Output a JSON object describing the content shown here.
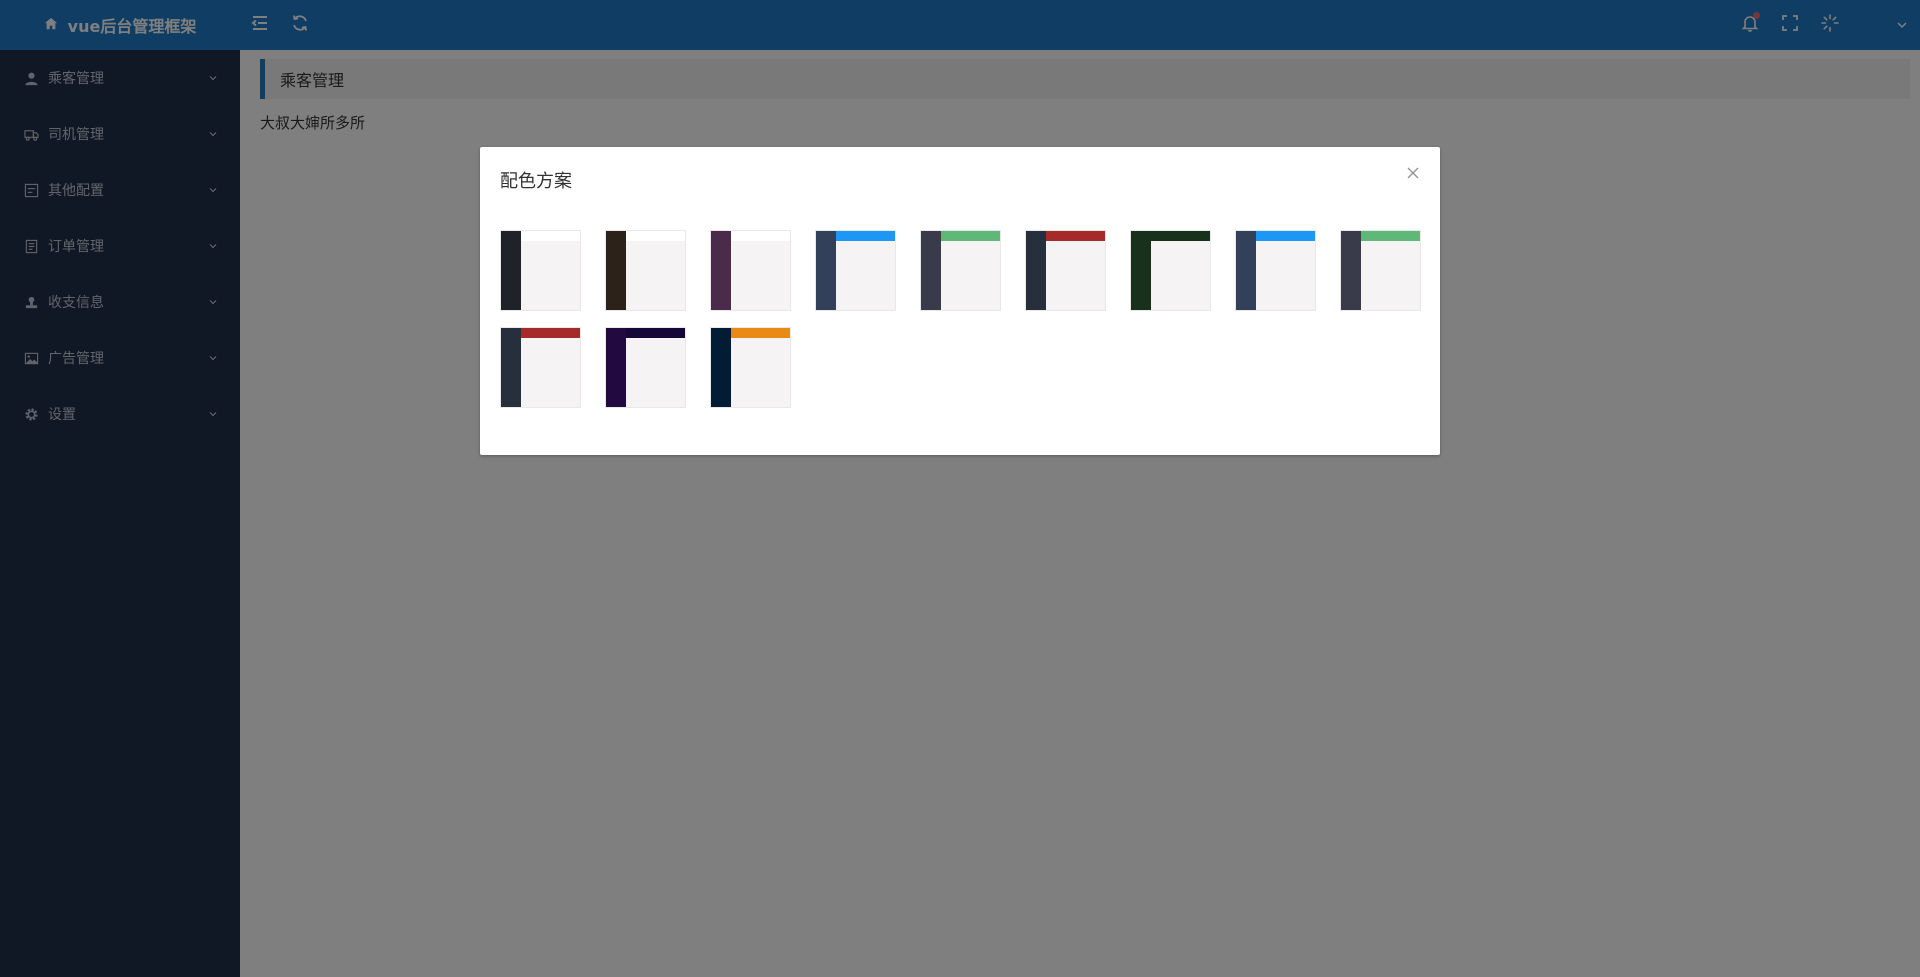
{
  "header": {
    "title": "vue后台管理框架",
    "bg": "#1e7bc6",
    "icons": [
      "home-icon",
      "menu-fold-icon",
      "refresh-icon",
      "bell-icon",
      "fullscreen-icon",
      "color-theme-icon",
      "chevron-down-icon"
    ]
  },
  "sidebar": {
    "bg": "#22314a",
    "items": [
      {
        "label": "乘客管理",
        "icon": "user-icon"
      },
      {
        "label": "司机管理",
        "icon": "truck-icon"
      },
      {
        "label": "其他配置",
        "icon": "config-icon"
      },
      {
        "label": "订单管理",
        "icon": "document-icon"
      },
      {
        "label": "收支信息",
        "icon": "stamp-icon"
      },
      {
        "label": "广告管理",
        "icon": "picture-icon"
      },
      {
        "label": "设置",
        "icon": "gear-icon"
      }
    ]
  },
  "main": {
    "page_title": "乘客管理",
    "content_text": "大叔大婶所多所"
  },
  "modal": {
    "title": "配色方案",
    "schemes": [
      {
        "side": "#1f2329",
        "top": "#ffffff"
      },
      {
        "side": "#2d2219",
        "top": "#ffffff"
      },
      {
        "side": "#4a2c4a",
        "top": "#ffffff"
      },
      {
        "side": "#324059",
        "top": "#1c97f4"
      },
      {
        "side": "#393b4b",
        "top": "#5fb878"
      },
      {
        "side": "#26303c",
        "top": "#a52b2b"
      },
      {
        "side": "#19301c",
        "top": "#19301c"
      },
      {
        "side": "#324059",
        "top": "#1c97f4"
      },
      {
        "side": "#393b4b",
        "top": "#5fb878"
      },
      {
        "side": "#26303c",
        "top": "#a52b2b"
      },
      {
        "side": "#22093f",
        "top": "#16073a"
      },
      {
        "side": "#021c33",
        "top": "#e88a14"
      }
    ]
  }
}
